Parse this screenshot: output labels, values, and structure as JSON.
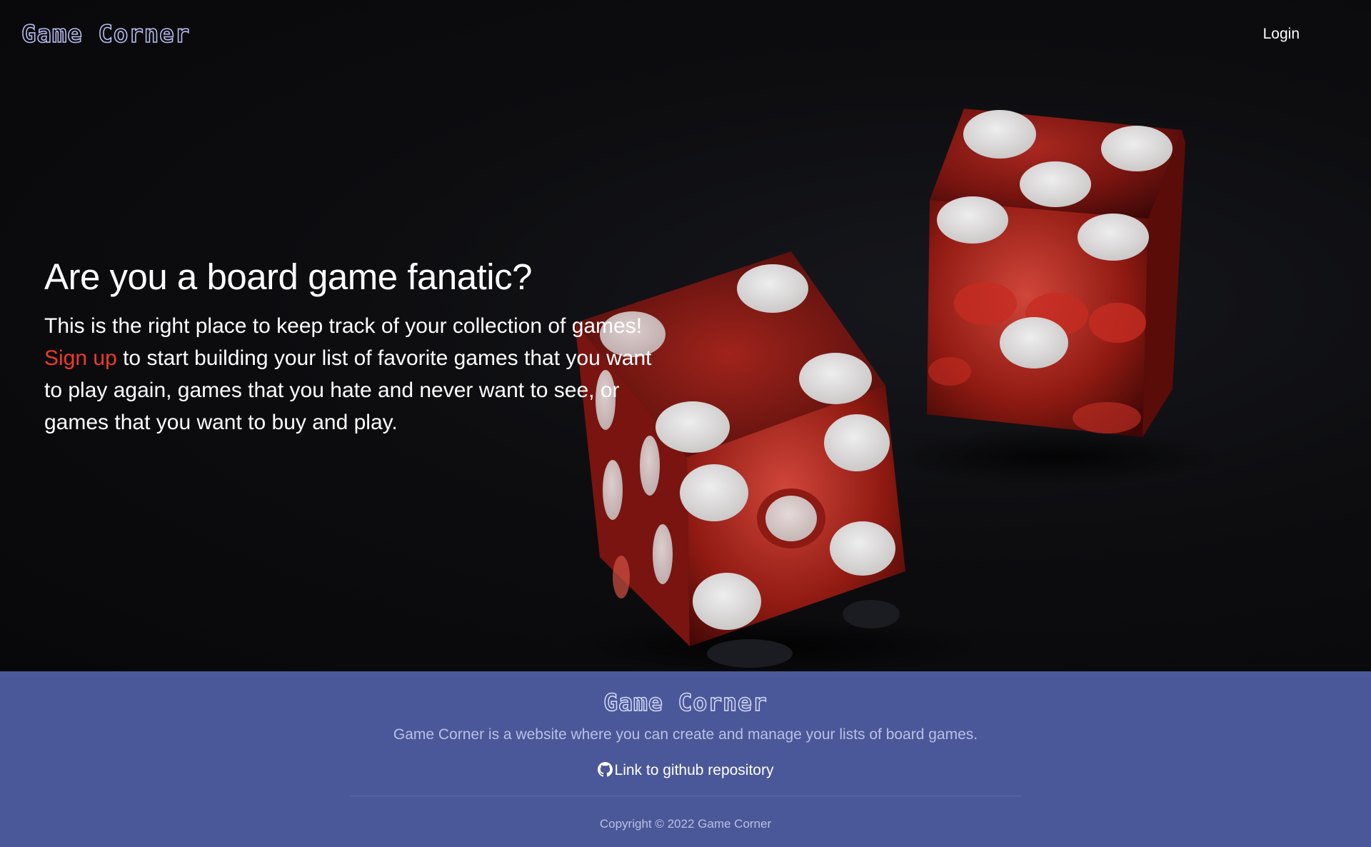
{
  "header": {
    "brand": "Game Corner",
    "login_label": "Login"
  },
  "hero": {
    "title": "Are you a board game fanatic?",
    "line1": "This is the right place to keep track of your collection of games!",
    "signup_label": "Sign up",
    "line2_rest": " to start building your list of favorite games that you want",
    "line3": "to play again, games that you hate and never want to see, or",
    "line4": "games that you want to buy and play.",
    "image_alt": "Two red translucent dice on a dark background"
  },
  "footer": {
    "brand": "Game Corner",
    "description": "Game Corner is a website where you can create and manage your lists of board games.",
    "github_label": "Link to github repository",
    "copyright": "Copyright © 2022 Game Corner"
  },
  "colors": {
    "accent_red": "#f0392b",
    "footer_bg": "#4a5899",
    "hero_bg": "#0b0b0d",
    "brand_outline": "#b7bdf0"
  },
  "icons": {
    "github": "github-icon"
  }
}
